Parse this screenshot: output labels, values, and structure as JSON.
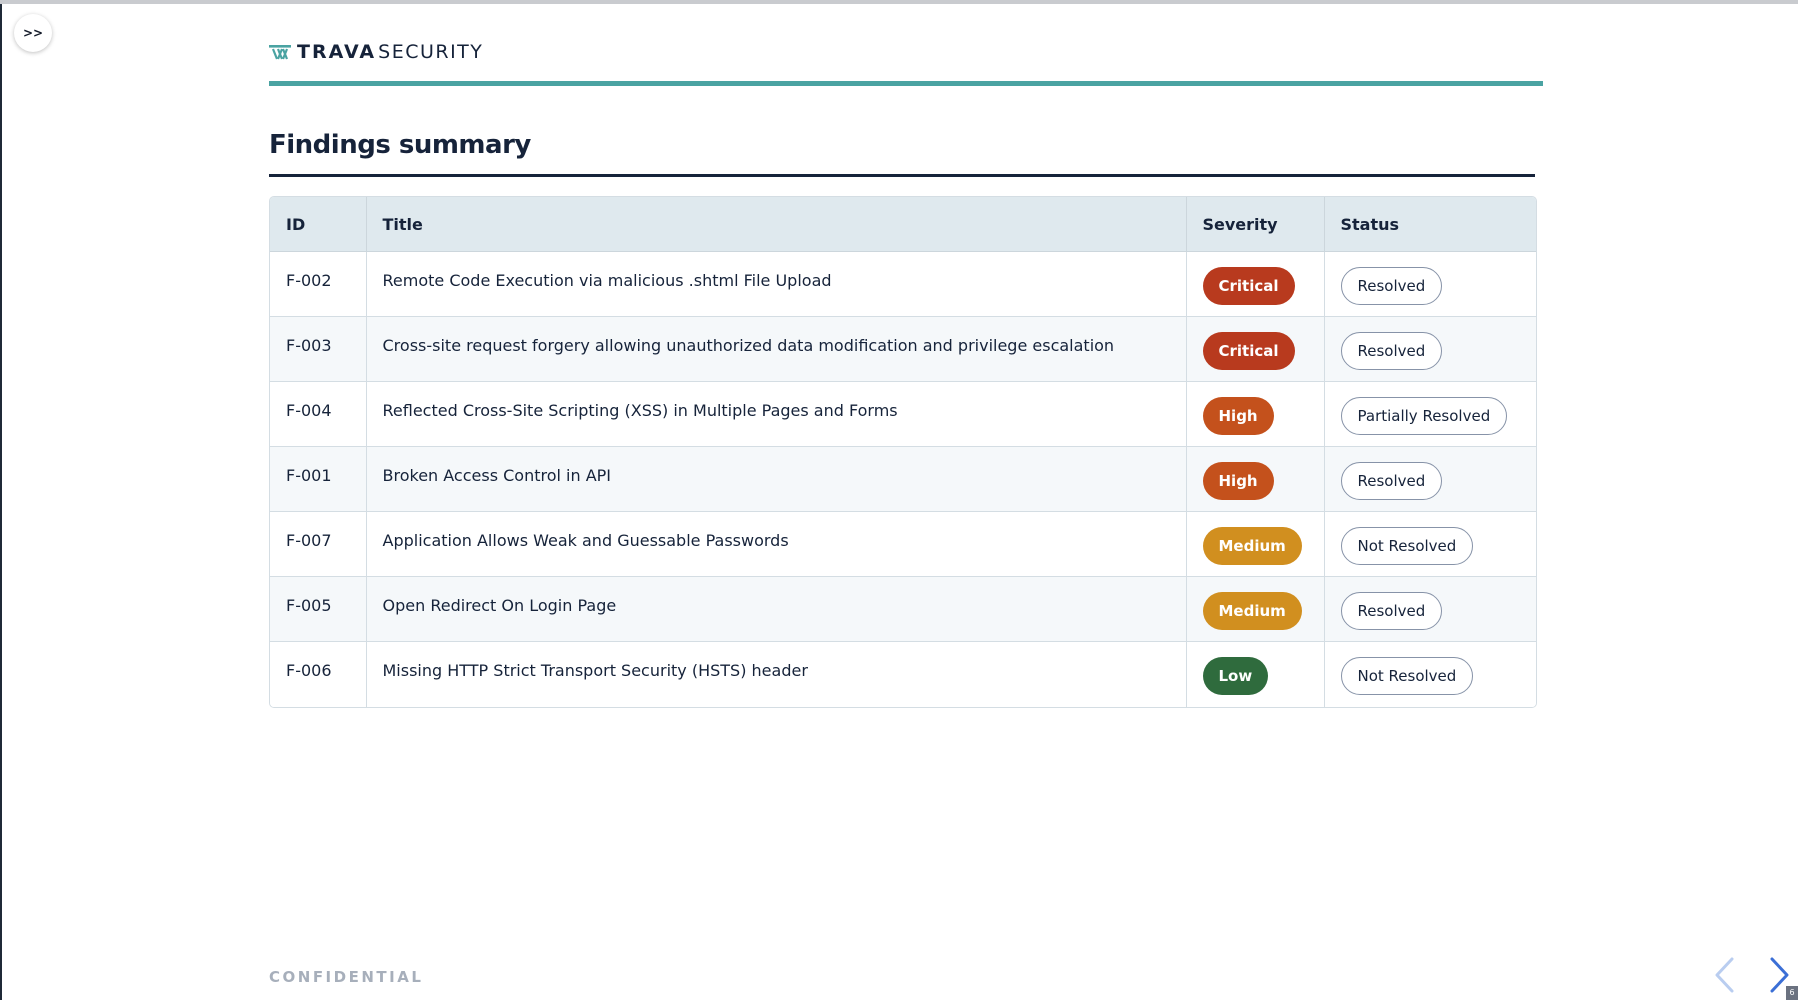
{
  "toggle": {
    "label": ">>"
  },
  "logo": {
    "brand_bold": "TRAVA",
    "brand_light": "SECURITY",
    "icon": "trava-logo-icon"
  },
  "section": {
    "title": "Findings summary"
  },
  "table": {
    "headers": {
      "id": "ID",
      "title": "Title",
      "severity": "Severity",
      "status": "Status"
    },
    "rows": [
      {
        "id": "F-002",
        "title": "Remote Code Execution via malicious .shtml File Upload",
        "severity": "Critical",
        "status": "Resolved"
      },
      {
        "id": "F-003",
        "title": "Cross-site request forgery allowing unauthorized data modification and privilege escalation",
        "severity": "Critical",
        "status": "Resolved"
      },
      {
        "id": "F-004",
        "title": "Reflected Cross-Site Scripting (XSS) in Multiple Pages and Forms",
        "severity": "High",
        "status": "Partially Resolved"
      },
      {
        "id": "F-001",
        "title": "Broken Access Control in API",
        "severity": "High",
        "status": "Resolved"
      },
      {
        "id": "F-007",
        "title": "Application Allows Weak and Guessable Passwords",
        "severity": "Medium",
        "status": "Not Resolved"
      },
      {
        "id": "F-005",
        "title": "Open Redirect On Login Page",
        "severity": "Medium",
        "status": "Resolved"
      },
      {
        "id": "F-006",
        "title": "Missing HTTP Strict Transport Security (HSTS) header",
        "severity": "Low",
        "status": "Not Resolved"
      }
    ]
  },
  "severity_colors": {
    "Critical": "#b83a1e",
    "High": "#c4511c",
    "Medium": "#d18f1f",
    "Low": "#2f6b3d"
  },
  "colors": {
    "accent_teal": "#4aa3a2",
    "nav_prev": "#b9cdf0",
    "nav_next": "#3b6fd6"
  },
  "footer": {
    "confidential": "CONFIDENTIAL",
    "page_number": "6"
  },
  "nav": {
    "prev_icon": "chevron-left-icon",
    "next_icon": "chevron-right-icon"
  }
}
